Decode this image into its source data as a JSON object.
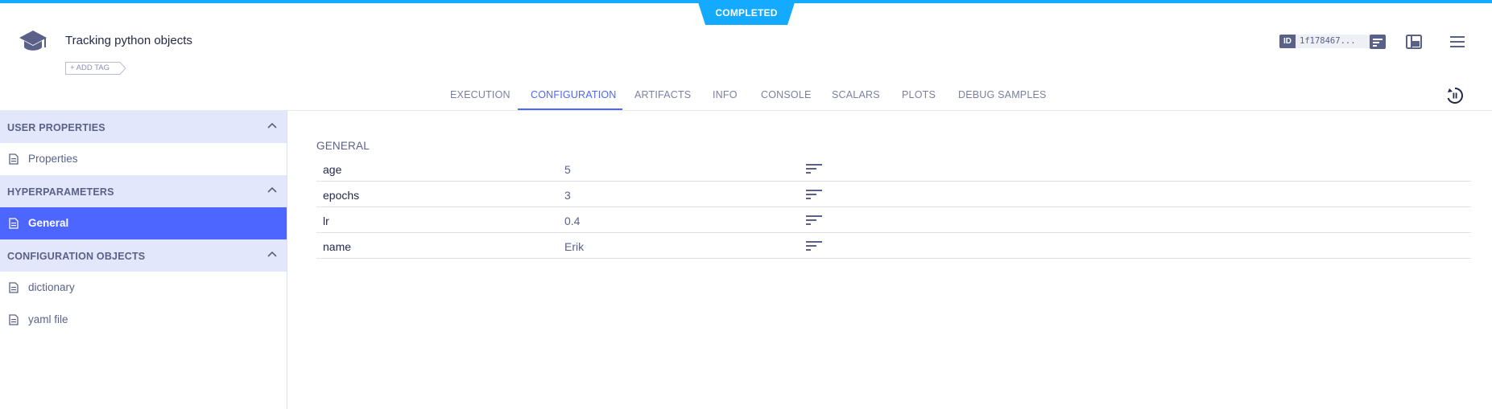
{
  "status": {
    "label": "COMPLETED",
    "color": "#14aaff"
  },
  "task": {
    "title": "Tracking python objects",
    "add_tag_label": "+ ADD TAG",
    "id_label": "ID",
    "id_value": "1f178467..."
  },
  "tabs": [
    {
      "label": "EXECUTION",
      "active": false
    },
    {
      "label": "CONFIGURATION",
      "active": true
    },
    {
      "label": "ARTIFACTS",
      "active": false
    },
    {
      "label": "INFO",
      "active": false
    },
    {
      "label": "CONSOLE",
      "active": false
    },
    {
      "label": "SCALARS",
      "active": false
    },
    {
      "label": "PLOTS",
      "active": false
    },
    {
      "label": "DEBUG SAMPLES",
      "active": false
    }
  ],
  "sidebar": {
    "sections": [
      {
        "title": "USER PROPERTIES",
        "items": [
          {
            "label": "Properties",
            "active": false
          }
        ]
      },
      {
        "title": "HYPERPARAMETERS",
        "items": [
          {
            "label": "General",
            "active": true
          }
        ]
      },
      {
        "title": "CONFIGURATION OBJECTS",
        "items": [
          {
            "label": "dictionary",
            "active": false
          },
          {
            "label": "yaml file",
            "active": false
          }
        ]
      }
    ]
  },
  "main": {
    "section_title": "GENERAL",
    "params": [
      {
        "name": "age",
        "value": "5"
      },
      {
        "name": "epochs",
        "value": "3"
      },
      {
        "name": "lr",
        "value": "0.4"
      },
      {
        "name": "name",
        "value": "Erik"
      }
    ]
  },
  "colors": {
    "accent": "#4d66ff",
    "section_bg": "#e3e7fb",
    "text_dark": "#242a49",
    "text_muted": "#5a6188"
  },
  "icons": [
    "graduation-cap-icon",
    "info-panel-icon",
    "layout-icon",
    "menu-icon",
    "auto-refresh-icon",
    "document-icon",
    "chevron-up-icon",
    "description-icon"
  ]
}
